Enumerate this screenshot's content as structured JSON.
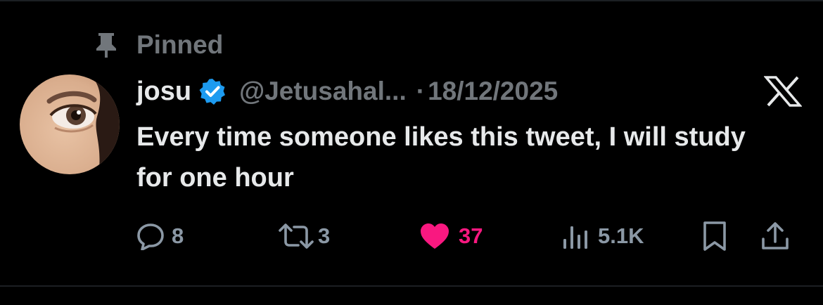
{
  "pinned": {
    "label": "Pinned"
  },
  "author": {
    "name": "josu",
    "handle": "@Jetusahal...",
    "separator": "·",
    "date": "18/12/2025",
    "verified": true
  },
  "tweet": {
    "text": "Every time someone likes this tweet, I will study for one hour"
  },
  "actions": {
    "replies": "8",
    "retweets": "3",
    "likes": "37",
    "views": "5.1K"
  },
  "icons": {
    "pin": "pin-icon",
    "verified": "verified-badge-icon",
    "platform": "x-logo-icon",
    "reply": "reply-icon",
    "retweet": "retweet-icon",
    "like": "heart-icon",
    "views": "views-chart-icon",
    "bookmark": "bookmark-icon",
    "share": "share-icon"
  },
  "colors": {
    "background": "#000000",
    "text": "#e7e9ea",
    "muted": "#71767b",
    "verified": "#1d9bf0",
    "like": "#f91880"
  }
}
